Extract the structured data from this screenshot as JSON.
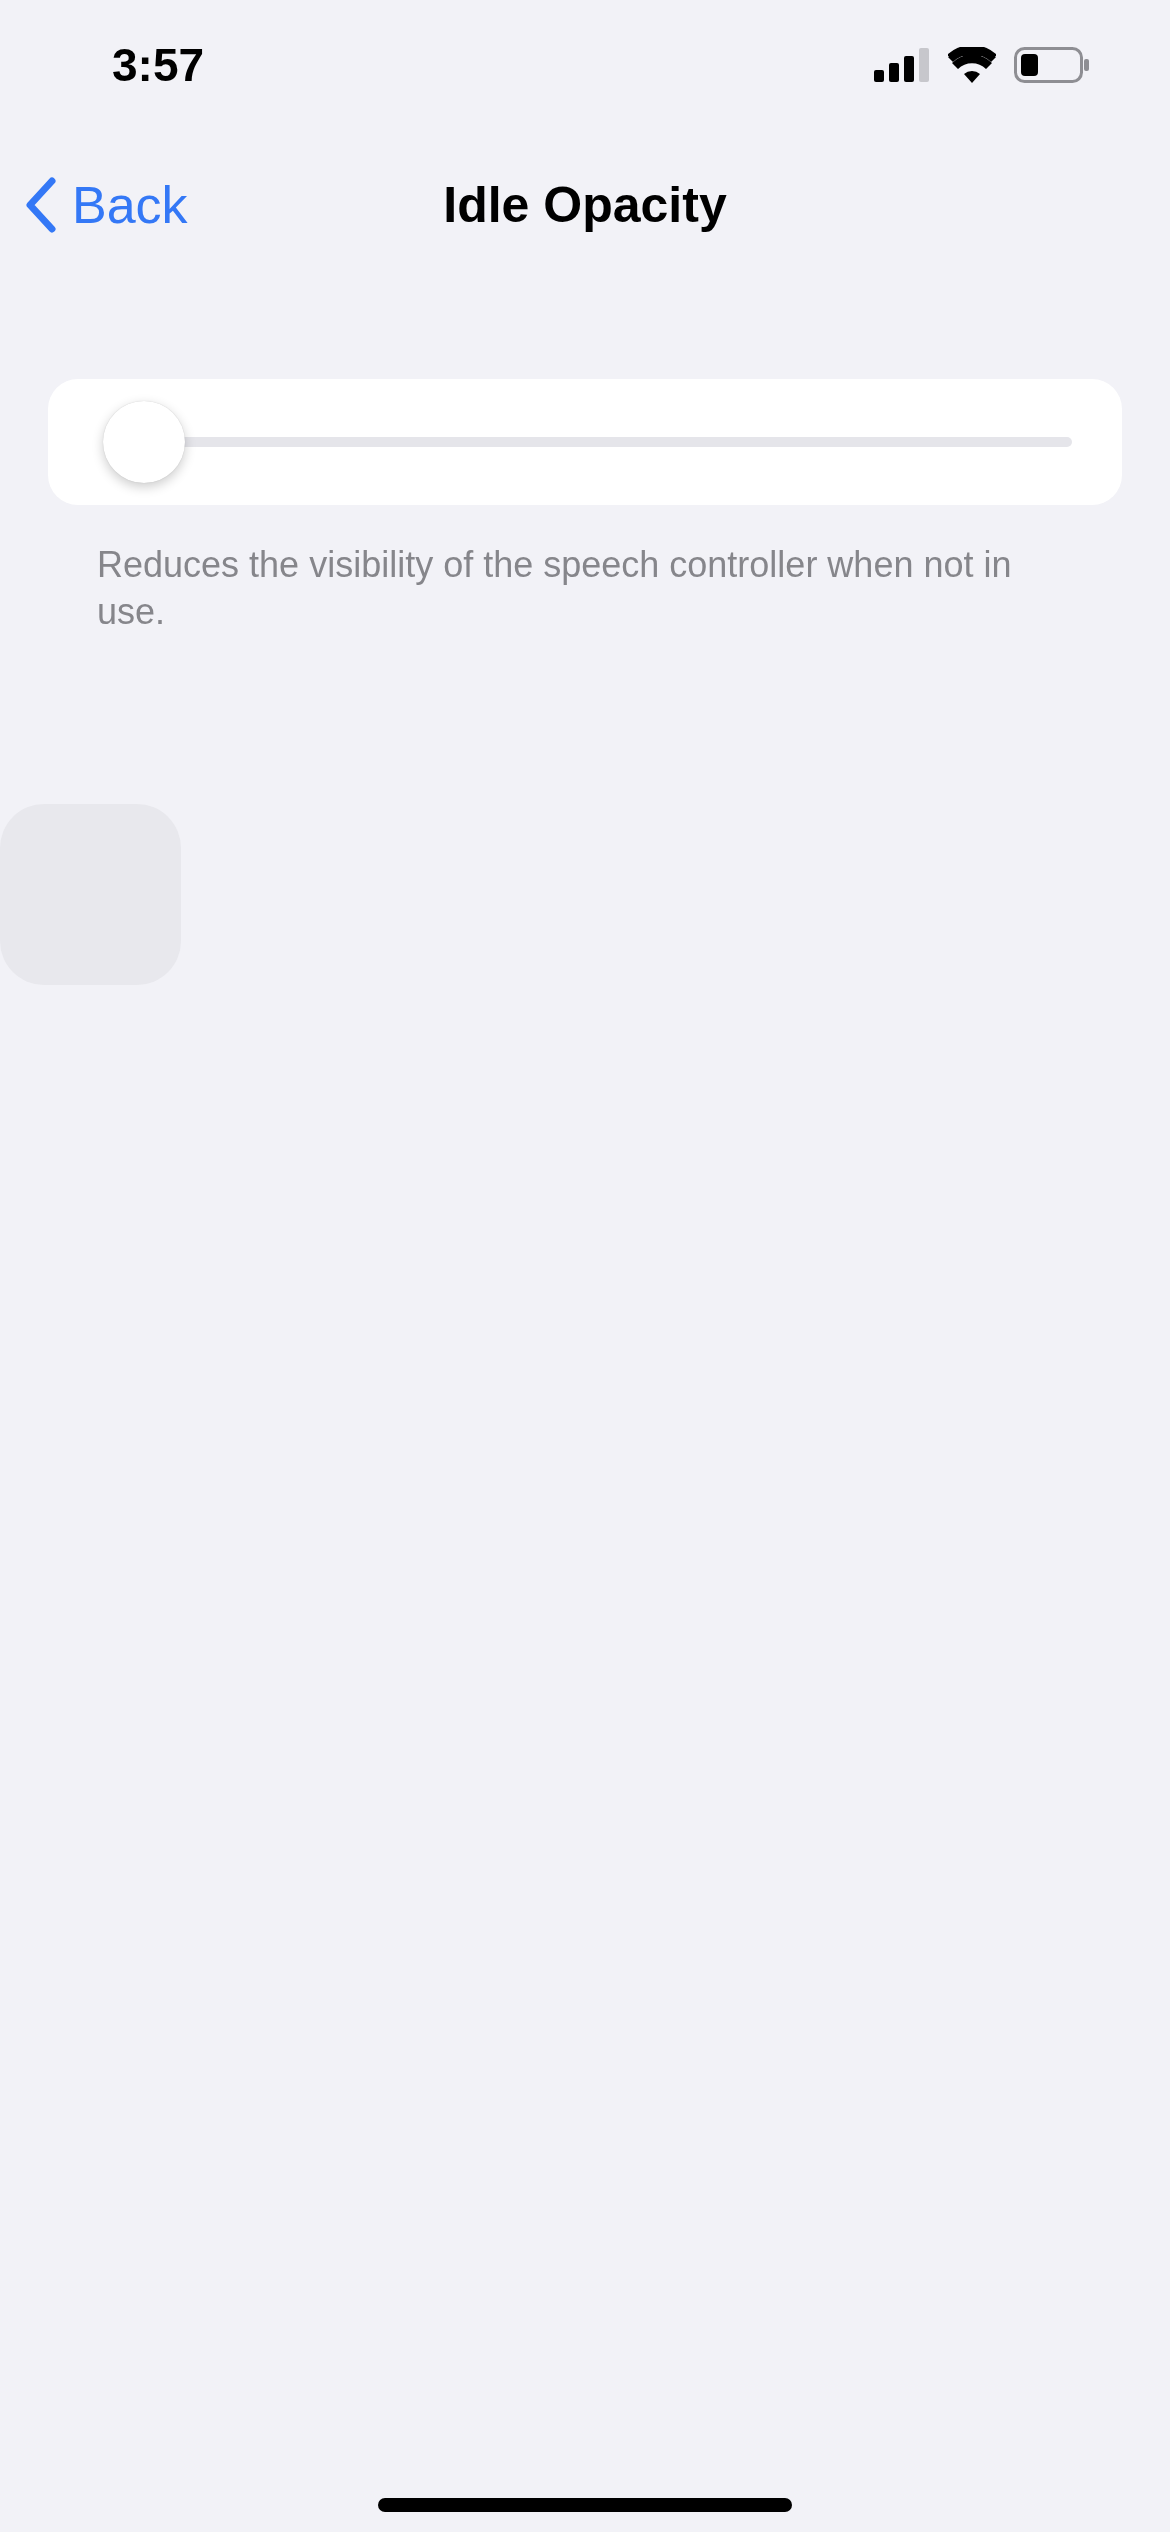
{
  "status_bar": {
    "time": "3:57"
  },
  "nav": {
    "back": "Back",
    "title": "Idle Opacity"
  },
  "slider": {
    "level": 0
  },
  "footer": "Reduces the visibility of the speech controller when not in use."
}
